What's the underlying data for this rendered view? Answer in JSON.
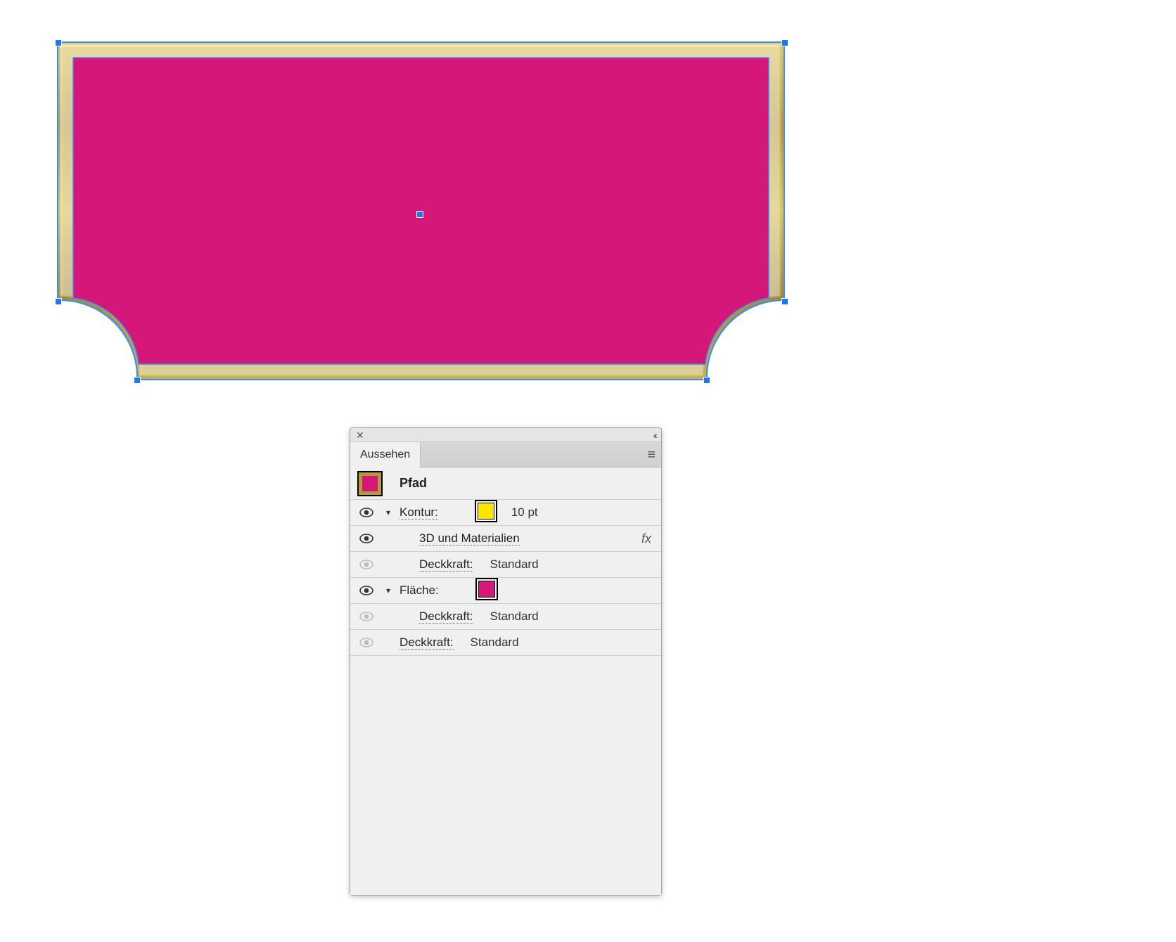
{
  "canvas": {
    "shape_type": "path-rounded-notch-rectangle",
    "fill_color": "#d6177a",
    "stroke_color_gold_1": "#cdb556",
    "stroke_color_gold_2": "#ab8f3c",
    "selection_outline_color": "#3a8cff",
    "handle_color": "#1e74ff"
  },
  "panel": {
    "title": "Aussehen",
    "object_label": "Pfad",
    "rows": {
      "stroke": {
        "label": "Kontur:",
        "value": "10 pt",
        "swatch_color": "#ffe600"
      },
      "effect": {
        "label": "3D und Materialien",
        "fx_glyph": "fx"
      },
      "opacity_stroke": {
        "label": "Deckkraft:",
        "value": "Standard"
      },
      "fill": {
        "label": "Fläche:",
        "swatch_color": "#d6177a"
      },
      "opacity_fill": {
        "label": "Deckkraft:",
        "value": "Standard"
      },
      "opacity_obj": {
        "label": "Deckkraft:",
        "value": "Standard"
      }
    }
  }
}
